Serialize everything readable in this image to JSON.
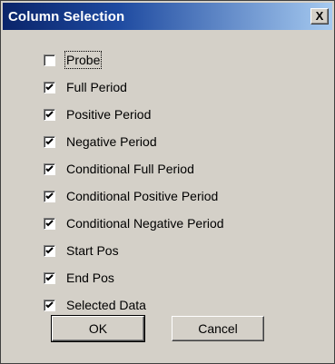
{
  "dialog": {
    "title": "Column Selection",
    "close_label": "X"
  },
  "options": [
    {
      "label": "Probe",
      "checked": false
    },
    {
      "label": "Full Period",
      "checked": true
    },
    {
      "label": "Positive Period",
      "checked": true
    },
    {
      "label": "Negative Period",
      "checked": true
    },
    {
      "label": "Conditional Full Period",
      "checked": true
    },
    {
      "label": "Conditional Positive Period",
      "checked": true
    },
    {
      "label": "Conditional Negative Period",
      "checked": true
    },
    {
      "label": "Start Pos",
      "checked": true
    },
    {
      "label": "End Pos",
      "checked": true
    },
    {
      "label": "Selected Data",
      "checked": true
    }
  ],
  "buttons": {
    "ok_label": "OK",
    "cancel_label": "Cancel"
  },
  "colors": {
    "titlebar_start": "#0a246a",
    "titlebar_end": "#a6caf0",
    "face": "#d4d0c8"
  }
}
